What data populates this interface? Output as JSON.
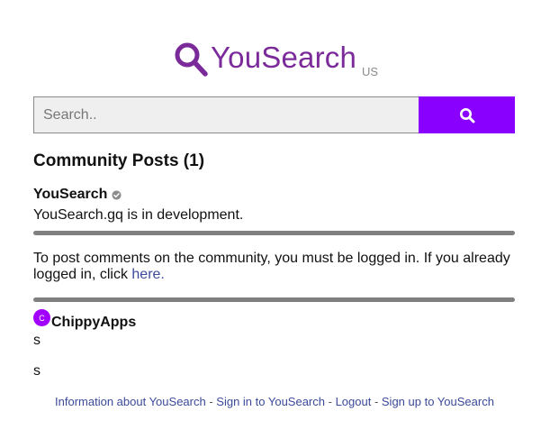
{
  "brand": {
    "name": "YouSearch",
    "region": "US",
    "color": "#7b2a9a"
  },
  "search": {
    "placeholder": "Search..",
    "value": "",
    "button_color": "#8a00ff",
    "button_icon": "search-icon"
  },
  "community": {
    "title": "Community Posts (1)",
    "post": {
      "author": "YouSearch",
      "verified_icon": "verified-icon",
      "body": "YouSearch.gq is in development."
    },
    "login_note": {
      "text": "To post comments on the community, you must be logged in. If you already logged in, click ",
      "link": "here."
    },
    "comments": [
      {
        "avatar_initial": "C",
        "author": "ChippyApps",
        "lines": [
          "s",
          "s"
        ]
      }
    ]
  },
  "footer": {
    "links": [
      "Information about YouSearch",
      "Sign in to YouSearch",
      "Logout",
      "Sign up to YouSearch"
    ],
    "separator": " - "
  }
}
